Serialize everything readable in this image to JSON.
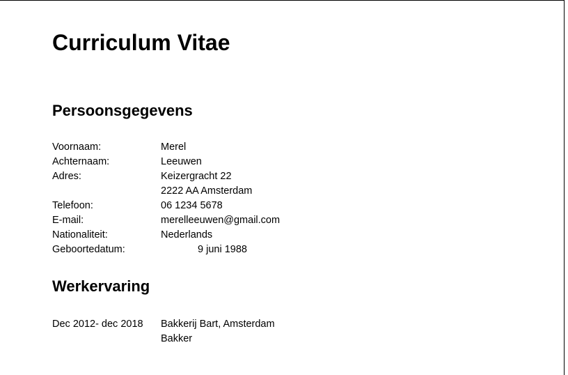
{
  "document": {
    "title": "Curriculum Vitae",
    "personal": {
      "heading": "Persoonsgegevens",
      "first_name": {
        "label": "Voornaam:",
        "value": "Merel"
      },
      "last_name": {
        "label": "Achternaam:",
        "value": "Leeuwen"
      },
      "address": {
        "label": "Adres:",
        "line1": "Keizergracht 22",
        "line2": "2222 AA Amsterdam"
      },
      "phone": {
        "label": "Telefoon:",
        "value": "06 1234 5678"
      },
      "email": {
        "label": "E-mail:",
        "value": "merelleeuwen@gmail.com"
      },
      "nationality": {
        "label": "Nationaliteit:",
        "value": "Nederlands"
      },
      "birthdate": {
        "label": "Geboortedatum:",
        "value": "9 juni 1988"
      }
    },
    "work": {
      "heading": "Werkervaring",
      "entries": [
        {
          "period": "Dec 2012- dec 2018",
          "employer": "Bakkerij Bart, Amsterdam",
          "role": "Bakker"
        }
      ]
    }
  }
}
